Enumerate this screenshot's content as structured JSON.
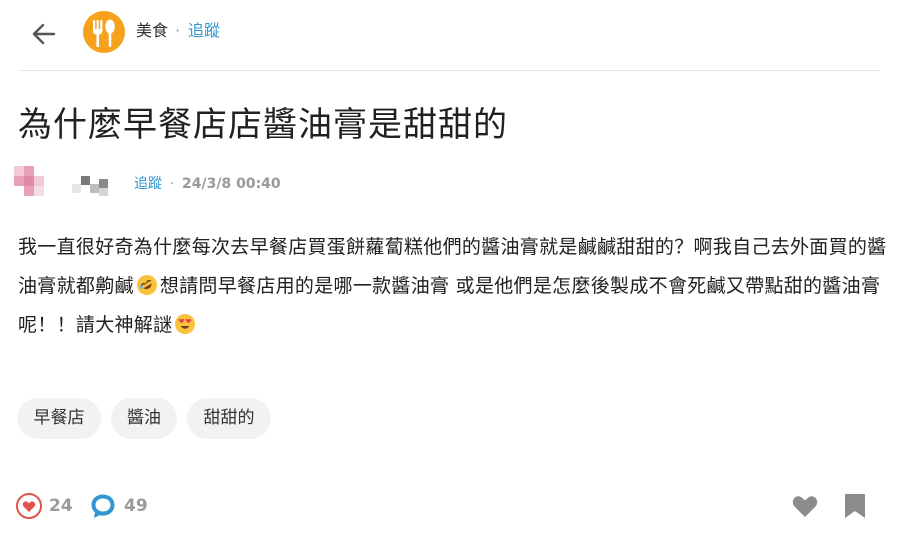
{
  "header": {
    "back_icon": "arrow-left-icon",
    "board_avatar_icon": "fork-spoon-icon",
    "board_avatar_color": "#f6a21c",
    "board_name": "美食",
    "separator": "·",
    "follow_label": "追蹤"
  },
  "post": {
    "title": "為什麼早餐店店醬油膏是甜甜的",
    "author": {
      "follow_label": "追蹤",
      "separator": "·",
      "timestamp": "24/3/8 00:40"
    },
    "body": {
      "part1": "我一直很好奇為什麼每次去早餐店買蛋餅蘿蔔糕他們的醬油膏就是鹹鹹甜甜的？啊我自己去外面買的醬油膏就都齁鹹",
      "emoji1": "rolling-on-floor-laughing-emoji",
      "part2": "想請問早餐店用的是哪一款醬油膏 或是他們是怎麼後製成不會死鹹又帶點甜的醬油膏呢！！請大神解謎",
      "emoji2": "heart-eyes-emoji"
    },
    "tags": [
      "早餐店",
      "醬油",
      "甜甜的"
    ]
  },
  "footer": {
    "like_icon": "heart-outline-icon",
    "like_count": "24",
    "comment_icon": "comment-bubble-icon",
    "comment_count": "49",
    "react_icon": "heart-icon",
    "bookmark_icon": "bookmark-icon"
  },
  "colors": {
    "accent": "#3397cf",
    "like": "#e0524c",
    "comment": "#3397cf",
    "muted_icon": "#8c8c8c",
    "tag_bg": "#f2f2f2"
  }
}
